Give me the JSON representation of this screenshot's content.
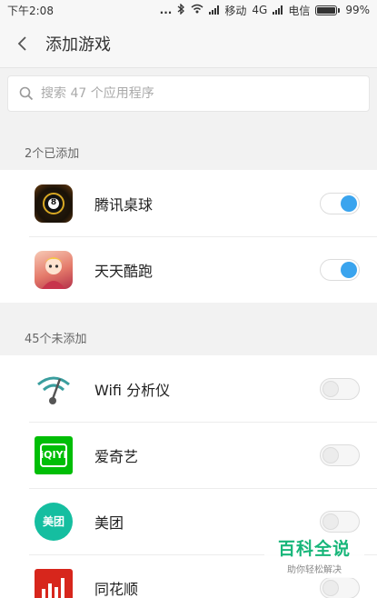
{
  "status_bar": {
    "time": "下午2:08",
    "dots": "...",
    "carrier1": "移动",
    "network": "4G",
    "carrier2": "电信",
    "battery": "99%"
  },
  "header": {
    "title": "添加游戏",
    "back_icon": "chevron-left-icon"
  },
  "search": {
    "placeholder": "搜索 47 个应用程序",
    "icon": "search-icon"
  },
  "sections": {
    "added_title": "2个已添加",
    "not_added_title": "45个未添加"
  },
  "added_apps": [
    {
      "name": "腾讯桌球",
      "icon": "billiards-8-ball-icon",
      "enabled": true
    },
    {
      "name": "天天酷跑",
      "icon": "parkour-game-icon",
      "enabled": true
    }
  ],
  "not_added_apps": [
    {
      "name": "Wifi 分析仪",
      "icon": "wifi-analyzer-icon",
      "enabled": false
    },
    {
      "name": "爱奇艺",
      "icon": "iqiyi-icon",
      "icon_text": "iQIYI",
      "enabled": false
    },
    {
      "name": "美团",
      "icon": "meituan-icon",
      "icon_text": "美团",
      "enabled": false
    },
    {
      "name": "同花顺",
      "icon": "tonghuashun-icon",
      "enabled": false
    }
  ],
  "watermark": {
    "main": "百科全说",
    "sub": "助你轻松解决"
  },
  "colors": {
    "toggle_on": "#3aa4ee",
    "background": "#f2f2f2",
    "iqiyi": "#00be06",
    "meituan": "#15bea0",
    "tonghuashun": "#d7261c",
    "watermark": "#18b67a"
  }
}
